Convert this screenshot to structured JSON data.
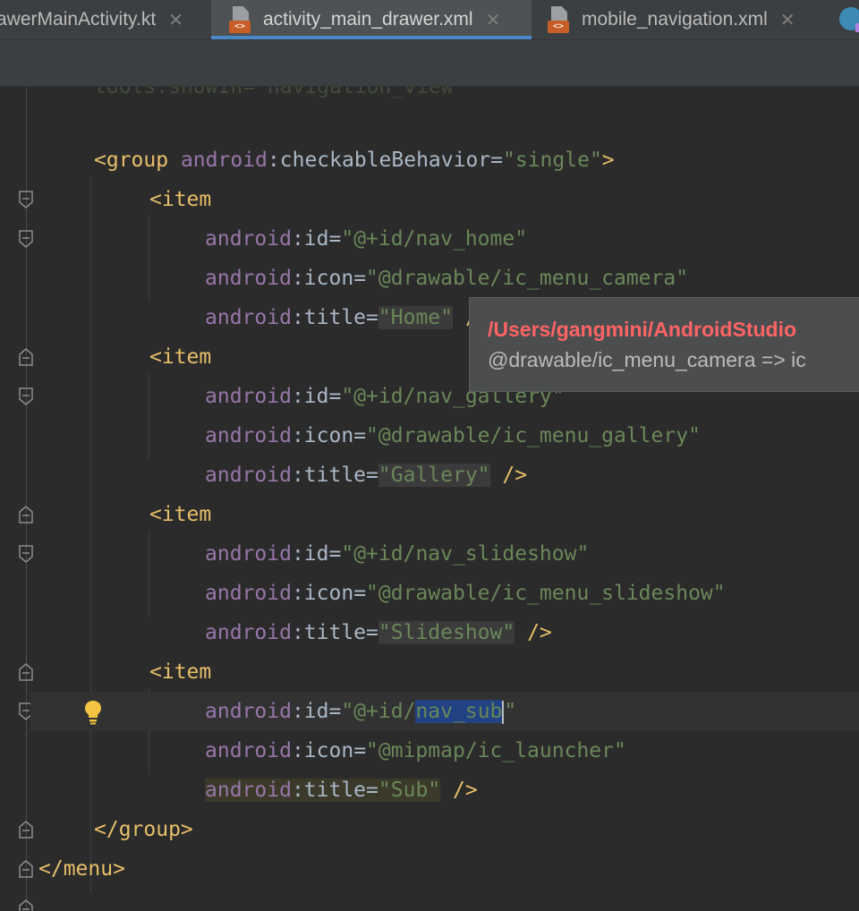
{
  "tabs": [
    {
      "label": "awerMainActivity.kt",
      "active": false,
      "icon": "kotlin-file-icon"
    },
    {
      "label": "activity_main_drawer.xml",
      "active": true,
      "icon": "xml-file-icon"
    },
    {
      "label": "mobile_navigation.xml",
      "active": false,
      "icon": "xml-file-icon"
    }
  ],
  "tab_close_glyph": "✕",
  "xml_badge": "<>",
  "tooltip": {
    "path": "/Users/gangmini/AndroidStudio",
    "resolution": "@drawable/ic_menu_camera => ic"
  },
  "code": {
    "l0": {
      "ns": "tools",
      "attr": "showIn",
      "val": "\"navigation_view\""
    },
    "group_open": {
      "tag": "<group",
      "ns": "android",
      "attr": "checkableBehavior",
      "val": "\"single\"",
      "end": ">"
    },
    "item1": {
      "open": "<item",
      "id": "\"@+id/nav_home\"",
      "icon": "\"@drawable/ic_menu_camera\"",
      "title": "\"Home\"",
      "close": " />"
    },
    "item2": {
      "open": "<item",
      "id": "\"@+id/nav_gallery\"",
      "icon": "\"@drawable/ic_menu_gallery\"",
      "title": "\"Gallery\"",
      "close": " />"
    },
    "item3": {
      "open": "<item",
      "id": "\"@+id/nav_slideshow\"",
      "icon": "\"@drawable/ic_menu_slideshow\"",
      "title": "\"Slideshow\"",
      "close": " />"
    },
    "item4": {
      "open": "<item",
      "id_pre": "\"@+id/",
      "id_sel": "nav_sub",
      "id_post": "\"",
      "icon": "\"@mipmap/ic_launcher\"",
      "title": "\"Sub\"",
      "close": " />"
    },
    "ns": "android",
    "colon": ":",
    "eq": "=",
    "attr_id": "id",
    "attr_icon": "icon",
    "attr_title": "title",
    "group_close": "</group>",
    "menu_close": "</menu>"
  },
  "colors": {
    "tag": "#e8bf6a",
    "namespace": "#9876aa",
    "value": "#6a8759",
    "error_path": "#ff6464",
    "selection": "#214283"
  }
}
